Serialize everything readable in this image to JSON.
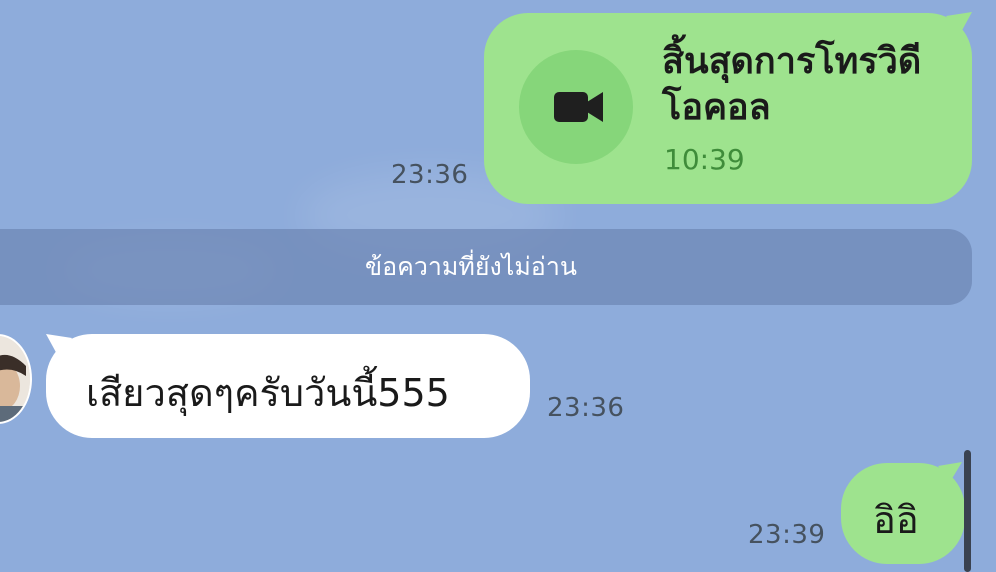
{
  "chat": {
    "messages": [
      {
        "id": "video-call-ended",
        "side": "outgoing",
        "title": "สิ้นสุดการโทรวิดีโอคอล",
        "duration": "10:39",
        "time": "23:36",
        "icon": "video-camera-icon"
      },
      {
        "id": "incoming-1",
        "side": "incoming",
        "text": "เสียวสุดๆครับวันนี้555",
        "time": "23:36"
      },
      {
        "id": "outgoing-1",
        "side": "outgoing",
        "text": "อิอิ",
        "time": "23:39"
      }
    ],
    "unread_divider": "ข้อความที่ยังไม่อ่าน"
  },
  "colors": {
    "background": "#8eacdb",
    "outgoing_bubble": "#9ee38e",
    "incoming_bubble": "#ffffff",
    "call_duration": "#3f8c3a"
  }
}
